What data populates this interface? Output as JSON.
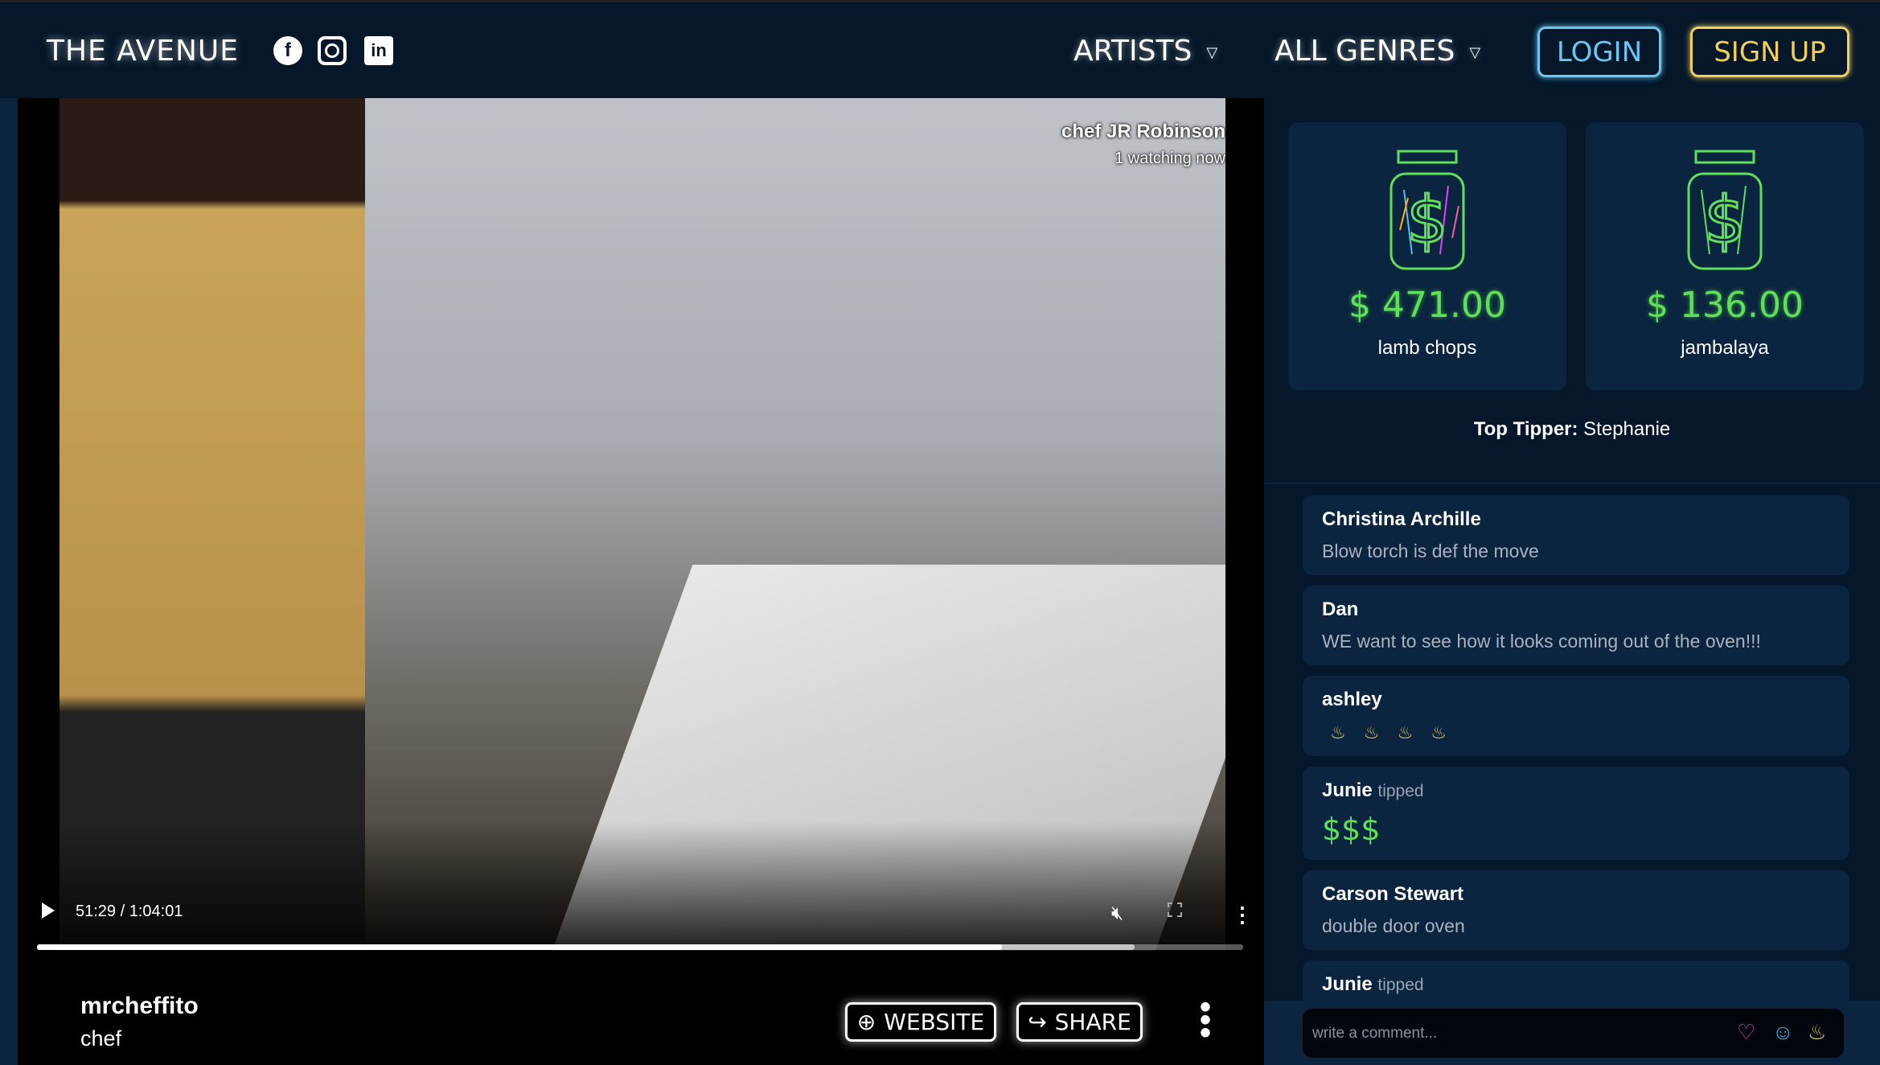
{
  "header": {
    "logo": "THE AVENUE",
    "social": [
      "facebook-icon",
      "instagram-icon",
      "linkedin-icon"
    ],
    "nav": [
      {
        "label": "ARTISTS"
      },
      {
        "label": "ALL GENRES"
      }
    ],
    "login": "LOGIN",
    "signup": "SIGN UP",
    "colors": {
      "login": "#6cc7f2",
      "signup": "#f0cf5a",
      "money": "#5fe05a"
    }
  },
  "video": {
    "streamer_display": "chef JR Robinson",
    "watching": "1 watching now",
    "time": "51:29 / 1:04:01",
    "played_fraction": 0.8,
    "buffered_fraction": 0.91,
    "muted": true
  },
  "streamer": {
    "username": "mrcheffito",
    "role": "chef",
    "website": "WEBSITE",
    "share": "SHARE"
  },
  "tip_jars": [
    {
      "amount": "$ 471.00",
      "label": "lamb chops"
    },
    {
      "amount": "$ 136.00",
      "label": "jambalaya"
    }
  ],
  "top_tipper": {
    "label": "Top Tipper:",
    "name": "Stephanie"
  },
  "comments": [
    {
      "name": "Christina Archille",
      "text": "Blow torch is def the move"
    },
    {
      "name": "Dan",
      "text": "WE want to see how it looks coming out of the oven!!!"
    },
    {
      "name": "ashley",
      "fires": 4
    },
    {
      "name": "Junie",
      "action": "tipped",
      "money": "$$$"
    },
    {
      "name": "Carson Stewart",
      "text": "double door oven"
    },
    {
      "name": "Junie",
      "action": "tipped",
      "money": "$$$"
    }
  ],
  "comment_input": {
    "placeholder": "write a comment...",
    "reactions": [
      "heart-icon",
      "smiley-icon",
      "fire-icon"
    ]
  }
}
